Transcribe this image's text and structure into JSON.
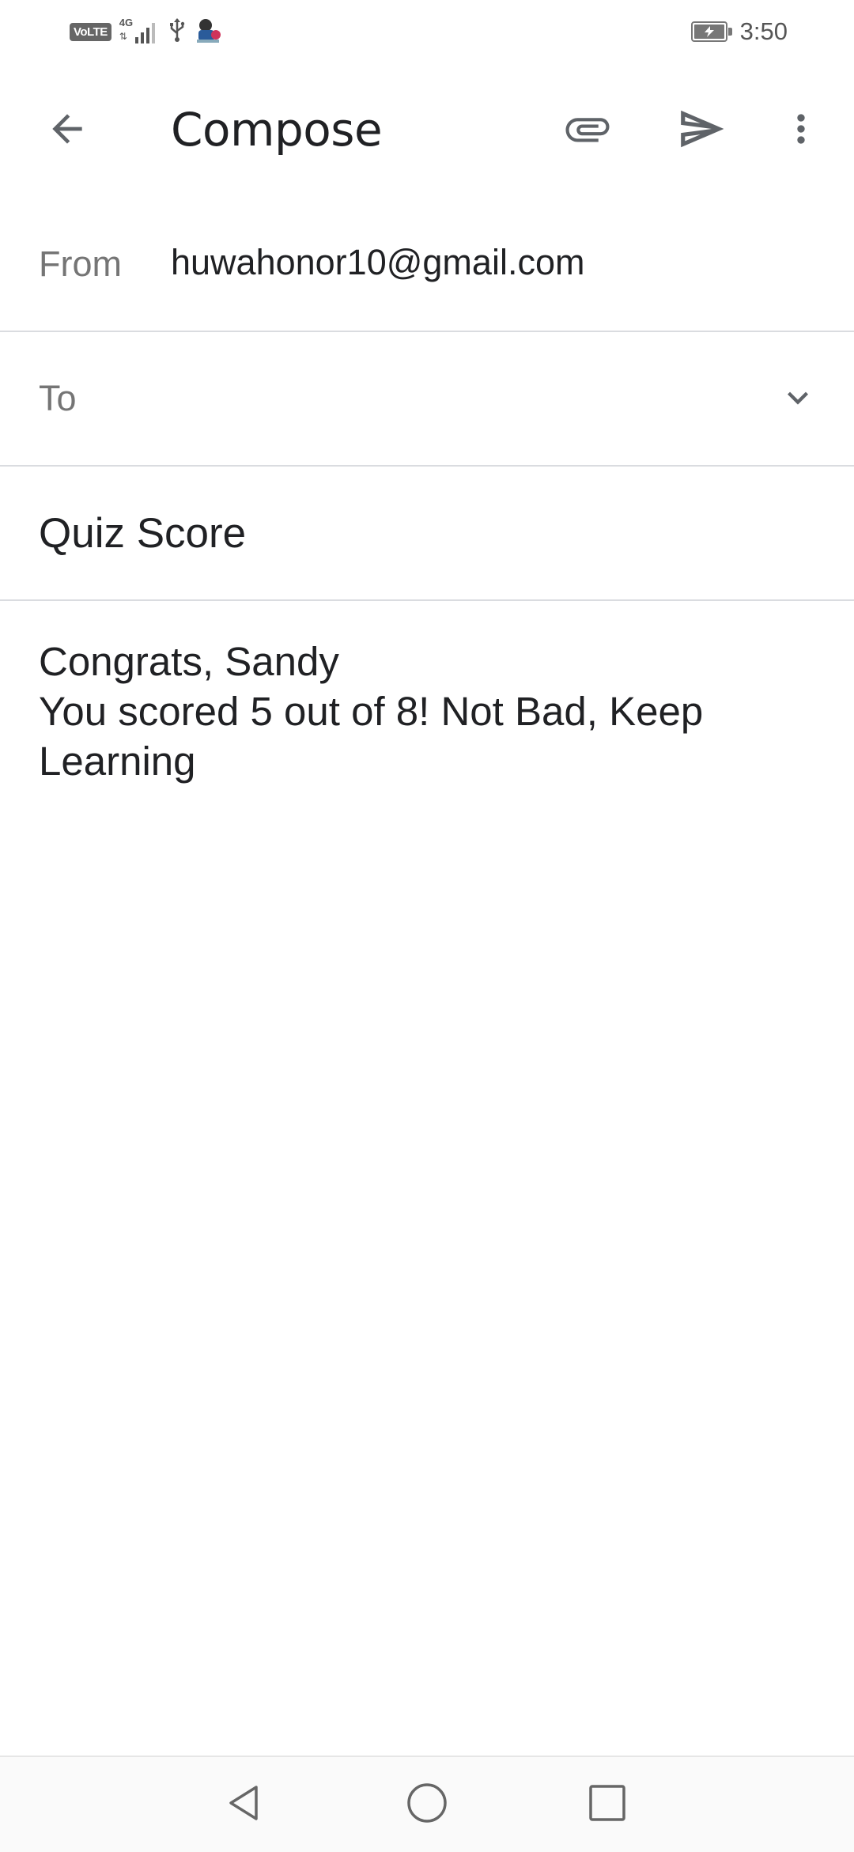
{
  "status_bar": {
    "network_badge": "VoLTE",
    "network_type": "4G",
    "data_arrows": "⇅",
    "usb_icon": "usb-icon",
    "notification_icon": "app-notification-icon",
    "battery_level": 1.0,
    "battery_charging": true,
    "time": "3:50"
  },
  "app_bar": {
    "title": "Compose",
    "icons": {
      "back": "arrow-back-icon",
      "attach": "paperclip-icon",
      "send": "send-icon",
      "more": "more-vert-icon"
    }
  },
  "compose": {
    "from_label": "From",
    "from_value": "huwahonor10@gmail.com",
    "to_label": "To",
    "subject": "Quiz Score",
    "body_lines": [
      "Congrats, Sandy",
      "You scored 5 out of 8! Not Bad, Keep",
      "Learning"
    ]
  },
  "nav_bar": {
    "icons": [
      "nav-back-icon",
      "nav-home-icon",
      "nav-recents-icon"
    ]
  },
  "colors": {
    "text_primary": "#202124",
    "text_secondary": "#757575",
    "divider": "#dadce0",
    "icon": "#5f6368"
  }
}
